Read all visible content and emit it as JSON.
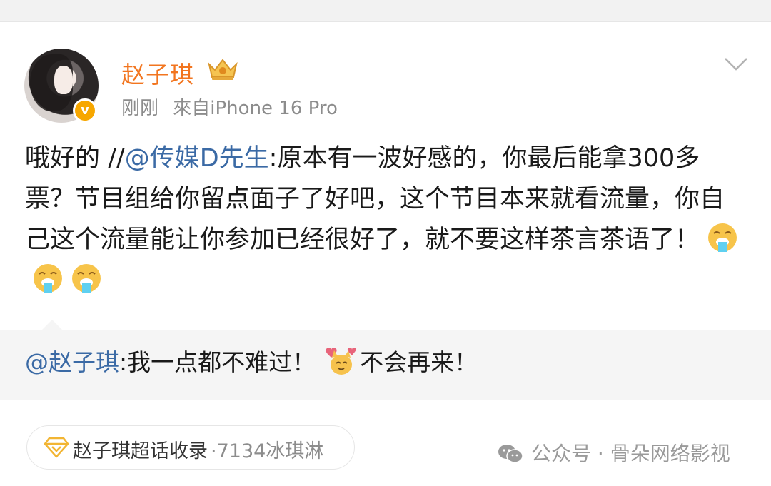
{
  "post": {
    "author": "赵子琪",
    "time": "刚刚",
    "source": "來自iPhone 16 Pro",
    "text_intro": "哦好的 //",
    "mention": "@传媒D先生",
    "text_body": ":原本有一波好感的，你最后能拿300多票？节目组给你留点面子了好吧，这个节目本来就看流量，你自己这个流量能让你参加已经很好了，就不要这样茶言茶语了！",
    "emojis": [
      "vomit-emoji",
      "vomit-emoji",
      "vomit-emoji"
    ]
  },
  "reply": {
    "mention": "@赵子琪",
    "text_before": ":我一点都不难过！",
    "emoji": "cat-heart-emoji",
    "text_after": "不会再来！"
  },
  "supertopic": {
    "label": "赵子琪超话收录",
    "count": "·7134冰琪淋"
  },
  "watermark": "公众号 · 骨朵网络影视",
  "colors": {
    "username": "#f2751f",
    "mention": "#3b6aa5",
    "badge": "#f7a700"
  }
}
